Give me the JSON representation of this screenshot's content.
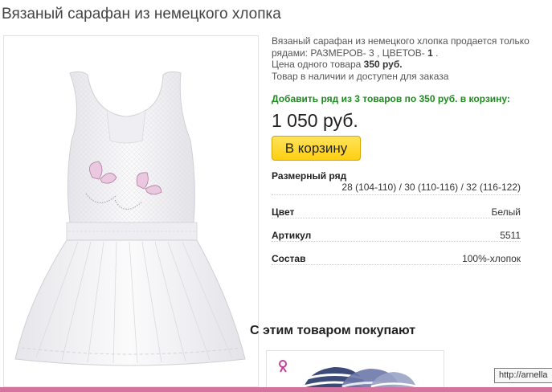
{
  "product": {
    "title": "Вязаный сарафан из немецкого хлопка",
    "desc_line1": "Вязаный сарафан из немецкого хлопка продается только",
    "desc_line2_prefix": "рядами: РАЗМЕРОВ- 3 , ЦВЕТОВ- ",
    "desc_colors_count": "1",
    "desc_line2_suffix": " .",
    "desc_line3_prefix": "Цена одного товара ",
    "desc_unit_price": "350 руб.",
    "desc_line4": "Товар в наличии и доступен для заказа",
    "offer_text": "Добавить ряд из 3 товаров по 350 руб. в корзину:",
    "price": "1 050 руб.",
    "cart_button_label": "В корзину"
  },
  "specs": {
    "size_label": "Размерный ряд",
    "size_values": "28 (104-110) / 30 (110-116) / 32 (116-122)",
    "rows": [
      {
        "key": "Цвет",
        "value": "Белый"
      },
      {
        "key": "Артикул",
        "value": "5511"
      },
      {
        "key": "Состав",
        "value": "100%-хлопок"
      }
    ]
  },
  "related": {
    "heading": "С этим товаром покупают"
  },
  "status": {
    "url_tooltip": "http://arnella"
  },
  "colors": {
    "offer_green": "#1f8a1f",
    "button_yellow": "#ffcf12",
    "bottom_bar_pink": "#d4739d",
    "accent_magenta": "#c0409a"
  },
  "icons": {
    "related_badge": "gift-bow-icon"
  }
}
